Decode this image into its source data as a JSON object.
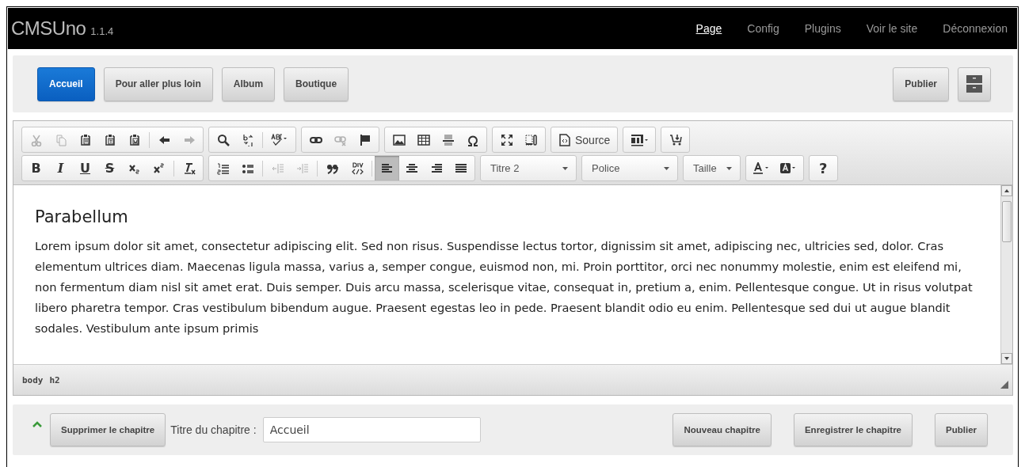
{
  "header": {
    "logo": "CMSUno",
    "version": "1.1.4",
    "nav": [
      {
        "label": "Page",
        "selected": true
      },
      {
        "label": "Config",
        "selected": false
      },
      {
        "label": "Plugins",
        "selected": false
      },
      {
        "label": "Voir le site",
        "selected": false
      },
      {
        "label": "Déconnexion",
        "selected": false
      }
    ]
  },
  "pages": {
    "tabs": [
      {
        "label": "Accueil",
        "selected": true
      },
      {
        "label": "Pour aller plus loin",
        "selected": false
      },
      {
        "label": "Album",
        "selected": false
      },
      {
        "label": "Boutique",
        "selected": false
      }
    ],
    "publish": "Publier"
  },
  "editor": {
    "toolbar_rows": [
      [
        {
          "items": [
            {
              "kind": "cut",
              "disabled": true
            },
            {
              "kind": "copy",
              "disabled": true
            },
            {
              "kind": "paste",
              "disabled": false
            },
            {
              "kind": "paste-text",
              "disabled": false
            },
            {
              "kind": "paste-word",
              "disabled": false
            },
            {
              "kind": "sep"
            },
            {
              "kind": "undo",
              "disabled": false
            },
            {
              "kind": "redo",
              "disabled": true
            }
          ]
        },
        {
          "items": [
            {
              "kind": "find",
              "disabled": false
            },
            {
              "kind": "replace",
              "disabled": false
            },
            {
              "kind": "sep"
            },
            {
              "kind": "spell",
              "disabled": false
            }
          ]
        },
        {
          "items": [
            {
              "kind": "link",
              "disabled": false
            },
            {
              "kind": "unlink",
              "disabled": true
            },
            {
              "kind": "anchor",
              "disabled": false
            }
          ]
        },
        {
          "items": [
            {
              "kind": "image",
              "disabled": false
            },
            {
              "kind": "table",
              "disabled": false
            },
            {
              "kind": "hline",
              "disabled": false
            },
            {
              "kind": "omega",
              "disabled": false
            }
          ]
        },
        {
          "items": [
            {
              "kind": "maximize",
              "disabled": false
            },
            {
              "kind": "blocks",
              "disabled": false
            }
          ]
        },
        {
          "items": [
            {
              "kind": "source",
              "label": "Source",
              "disabled": false
            }
          ]
        },
        {
          "items": [
            {
              "kind": "templates",
              "disabled": false
            }
          ]
        },
        {
          "items": [
            {
              "kind": "cart",
              "disabled": false
            }
          ]
        }
      ],
      [
        {
          "items": [
            {
              "kind": "bold",
              "label": "B",
              "disabled": false
            },
            {
              "kind": "italic",
              "label": "I",
              "disabled": false
            },
            {
              "kind": "underline",
              "label": "U",
              "disabled": false
            },
            {
              "kind": "strike",
              "label": "S",
              "disabled": false
            },
            {
              "kind": "subscript",
              "disabled": false
            },
            {
              "kind": "superscript",
              "disabled": false
            },
            {
              "kind": "sep"
            },
            {
              "kind": "clear-format",
              "disabled": false
            }
          ]
        },
        {
          "items": [
            {
              "kind": "numbered-list",
              "disabled": false
            },
            {
              "kind": "bullet-list",
              "disabled": false
            },
            {
              "kind": "sep"
            },
            {
              "kind": "outdent",
              "disabled": true
            },
            {
              "kind": "indent",
              "disabled": true
            },
            {
              "kind": "sep"
            },
            {
              "kind": "quote",
              "disabled": false
            },
            {
              "kind": "div",
              "disabled": false
            },
            {
              "kind": "sep"
            },
            {
              "kind": "align-left",
              "disabled": false,
              "selected": true
            },
            {
              "kind": "align-center",
              "disabled": false,
              "selected": false
            },
            {
              "kind": "align-right",
              "disabled": false,
              "selected": false
            },
            {
              "kind": "justify",
              "disabled": false,
              "selected": false
            }
          ]
        },
        {
          "items": [
            {
              "kind": "combo",
              "label": "Titre 2"
            }
          ]
        },
        {
          "items": [
            {
              "kind": "combo",
              "label": "Police"
            }
          ]
        },
        {
          "items": [
            {
              "kind": "small-combo",
              "label": "Taille"
            }
          ]
        },
        {
          "items": [
            {
              "kind": "text-color",
              "disabled": false
            },
            {
              "kind": "bg-color",
              "disabled": false
            }
          ]
        },
        {
          "items": [
            {
              "kind": "help",
              "label": "?",
              "disabled": false
            }
          ]
        }
      ]
    ],
    "heading": "Parabellum",
    "paragraph": "Lorem ipsum dolor sit amet, consectetur adipiscing elit. Sed non risus. Suspendisse lectus tortor, dignissim sit amet, adipiscing nec, ultricies sed, dolor. Cras elementum ultrices diam. Maecenas ligula massa, varius a, semper congue, euismod non, mi. Proin porttitor, orci nec nonummy molestie, enim est eleifend mi, non fermentum diam nisl sit amet erat. Duis semper. Duis arcu massa, scelerisque vitae, consequat in, pretium a, enim. Pellentesque congue. Ut in risus volutpat libero pharetra tempor. Cras vestibulum bibendum augue. Praesent egestas leo in pede. Praesent blandit odio eu enim. Pellentesque sed dui ut augue blandit sodales. Vestibulum ante ipsum primis",
    "path": [
      "body",
      "h2"
    ]
  },
  "chapter": {
    "delete": "Supprimer le chapitre",
    "title_label": "Titre du chapitre :",
    "title_value": "Accueil",
    "new": "Nouveau chapitre",
    "save": "Enregistrer le chapitre",
    "publish": "Publier"
  }
}
